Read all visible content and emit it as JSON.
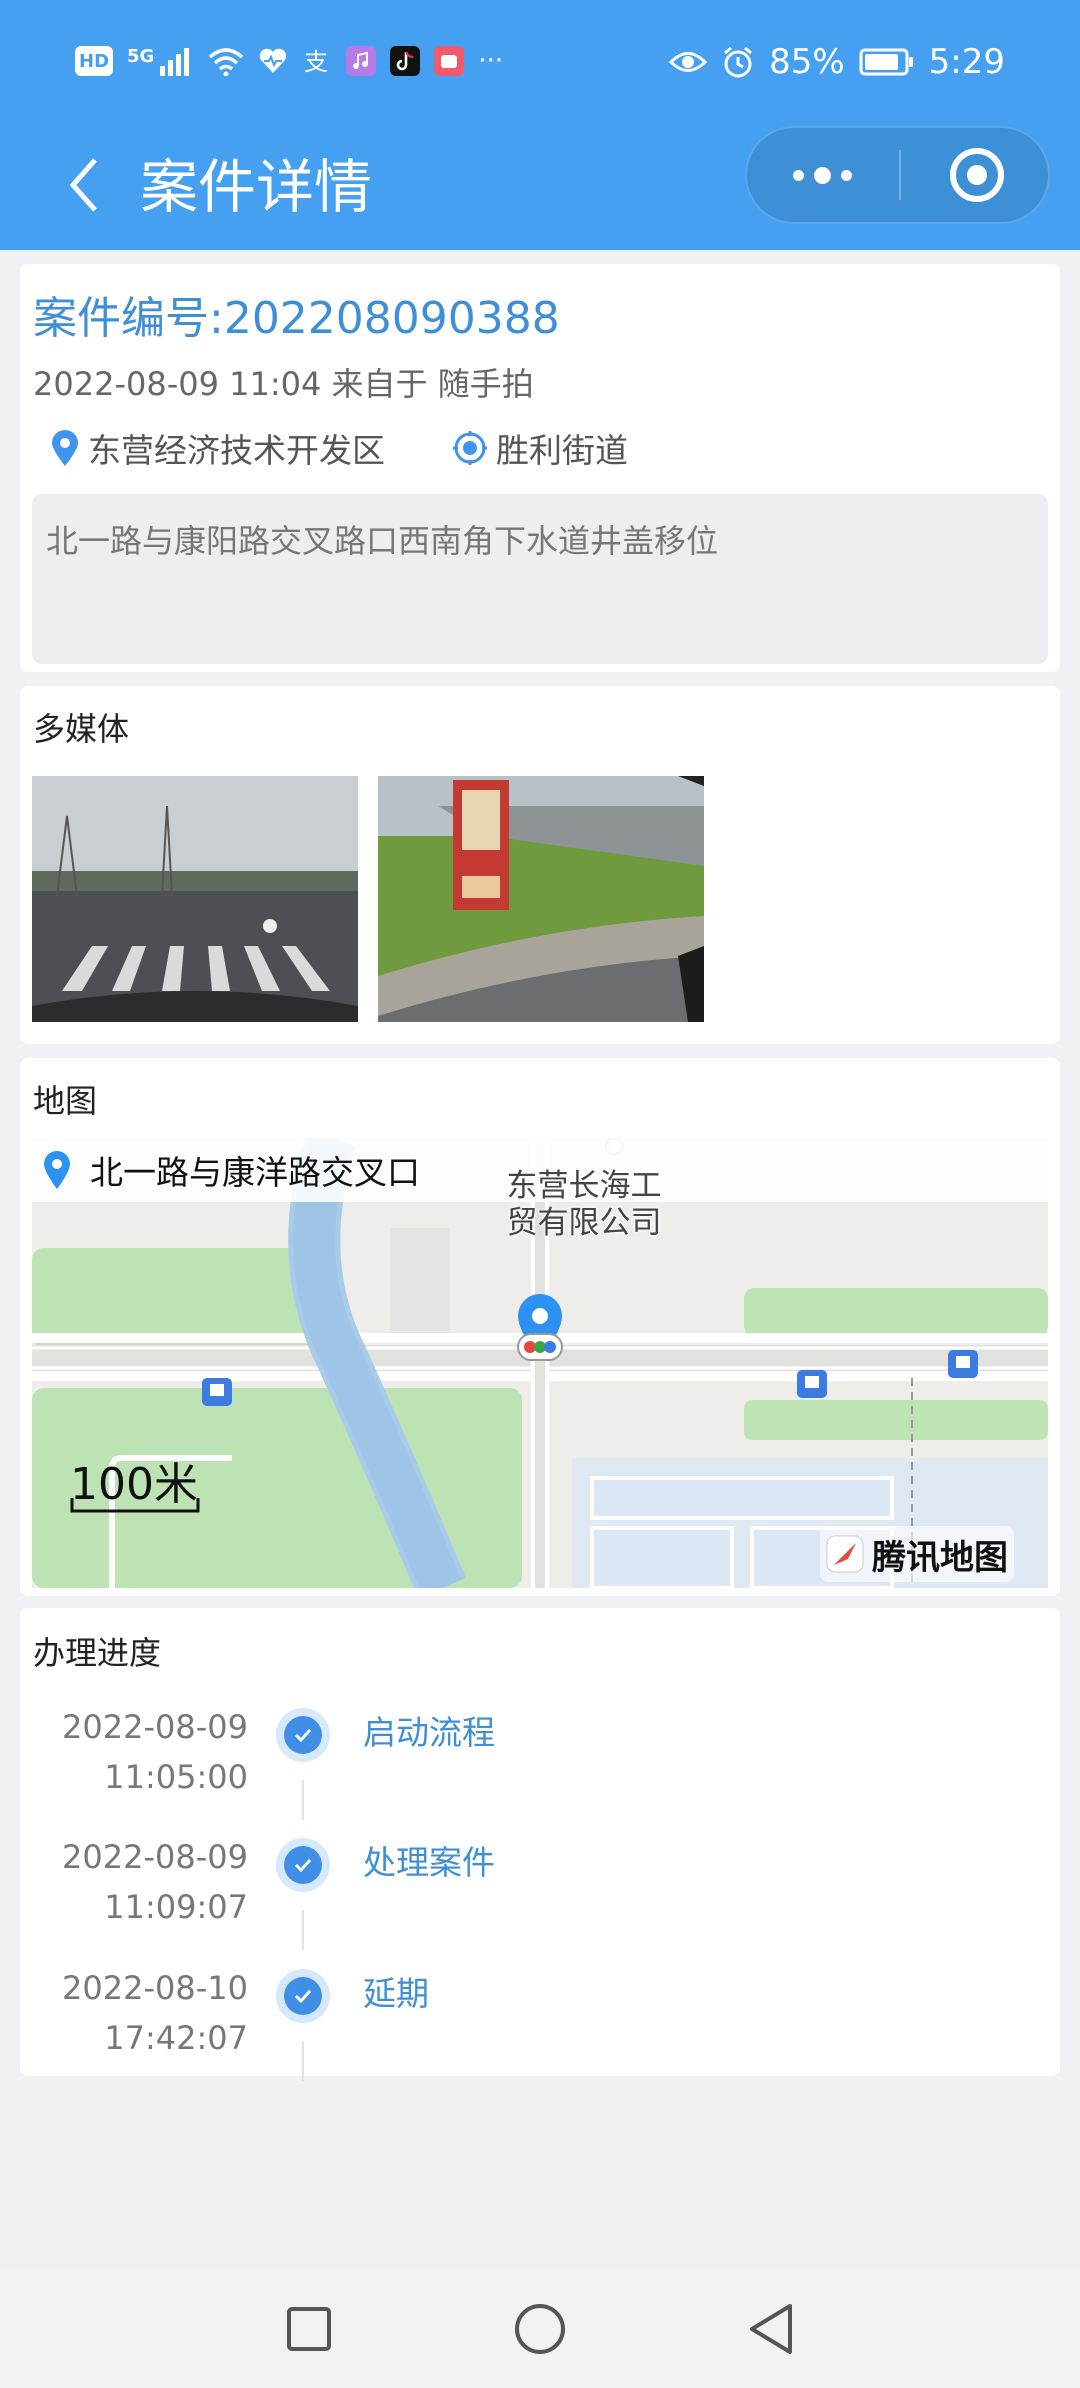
{
  "status_bar": {
    "hd": "HD",
    "network": "5G",
    "more": "···",
    "battery": "85%",
    "time": "5:29"
  },
  "nav": {
    "title": "案件详情"
  },
  "case": {
    "number": "案件编号:202208090388",
    "meta": "2022-08-09 11:04 来自于 随手拍",
    "district": "东营经济技术开发区",
    "street": "胜利街道",
    "description": "北一路与康阳路交叉路口西南角下水道井盖移位"
  },
  "media": {
    "title": "多媒体"
  },
  "map": {
    "title": "地图",
    "address": "北一路与康洋路交叉口",
    "poi": "东营长海工贸有限公司",
    "scale": "100米",
    "brand": "腾讯地图"
  },
  "progress": {
    "title": "办理进度",
    "steps": [
      {
        "date": "2022-08-09",
        "time": "11:05:00",
        "label": "启动流程"
      },
      {
        "date": "2022-08-09",
        "time": "11:09:07",
        "label": "处理案件"
      },
      {
        "date": "2022-08-10",
        "time": "17:42:07",
        "label": "延期"
      }
    ]
  },
  "colors": {
    "header": "#45a0f2",
    "accent": "#3f8fd6",
    "background": "#f0f1f4"
  }
}
